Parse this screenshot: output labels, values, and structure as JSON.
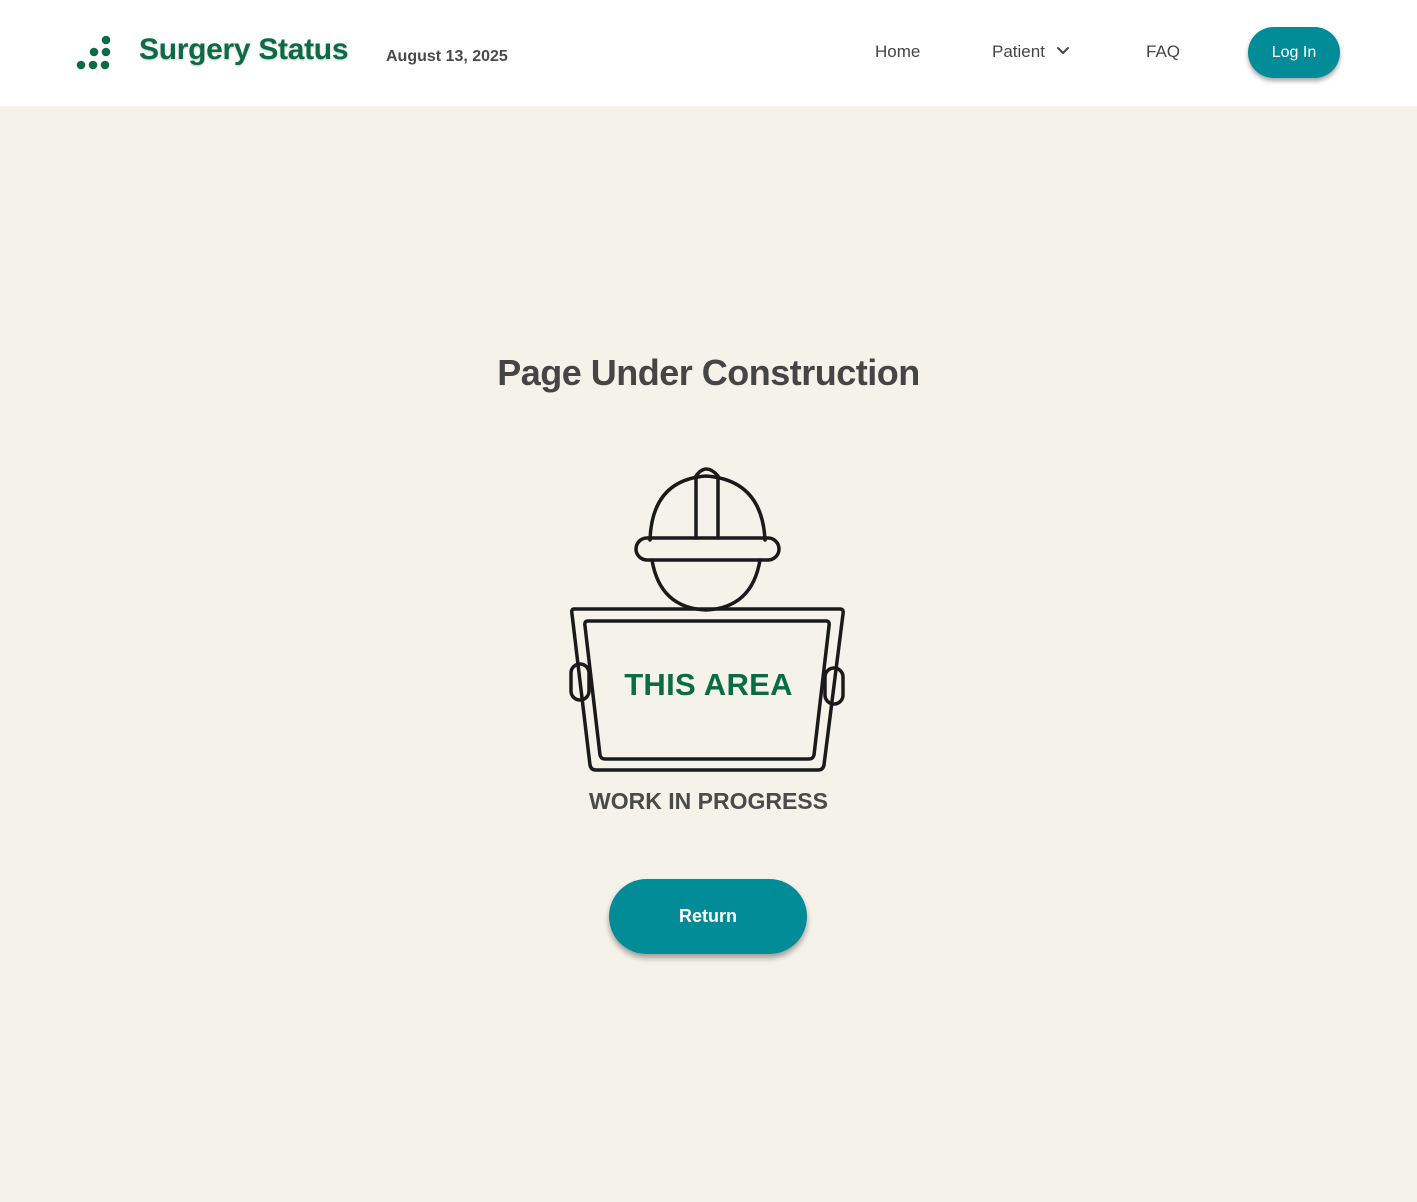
{
  "header": {
    "brand": "Surgery Status",
    "date": "August 13, 2025",
    "nav": {
      "home": "Home",
      "patient": "Patient",
      "faq": "FAQ"
    },
    "login_label": "Log In"
  },
  "main": {
    "title": "Page Under Construction",
    "sign_text": "THIS AREA",
    "status_text": "WORK IN PROGRESS",
    "return_label": "Return"
  },
  "colors": {
    "brand_green": "#0b6b45",
    "accent_teal": "#028c98",
    "background": "#f5f2ea"
  },
  "icons": {
    "logo": "dots-logo-icon",
    "patient_menu": "chevron-down-icon",
    "illustration": "construction-worker-sign-icon"
  }
}
